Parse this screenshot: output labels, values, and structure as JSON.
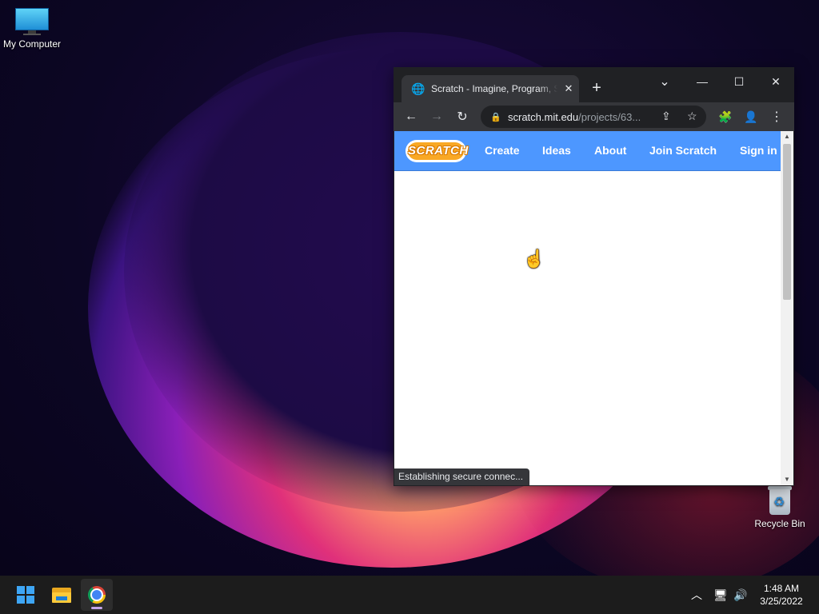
{
  "desktop": {
    "icons": [
      {
        "label": "My Computer"
      },
      {
        "label": "Recycle Bin"
      }
    ]
  },
  "browser": {
    "tab": {
      "title": "Scratch - Imagine, Program, Share",
      "close_glyph": "✕"
    },
    "new_tab_glyph": "+",
    "window_controls": {
      "tab_search": "⌄",
      "minimize": "—",
      "maximize": "☐",
      "close": "✕"
    },
    "toolbar": {
      "back": "←",
      "forward": "→",
      "reload": "↻",
      "url_host": "scratch.mit.edu",
      "url_path": "/projects/63...",
      "lock": "🔒",
      "share": "⇪",
      "star": "☆",
      "extensions": "🧩",
      "profile": "👤",
      "menu": "⋮"
    },
    "page": {
      "logo": "SCRATCH",
      "nav": [
        "Create",
        "Ideas",
        "About",
        "Join Scratch",
        "Sign in"
      ]
    },
    "status": "Establishing secure connec..."
  },
  "taskbar": {
    "tray": {
      "chevron": "︿",
      "network": "🖥",
      "volume": "🔊"
    },
    "time": "1:48 AM",
    "date": "3/25/2022"
  },
  "colors": {
    "scratch_blue": "#4d97ff",
    "chrome_dark": "#202124",
    "chrome_toolbar": "#35363a",
    "taskbar": "#1c1c1c"
  }
}
